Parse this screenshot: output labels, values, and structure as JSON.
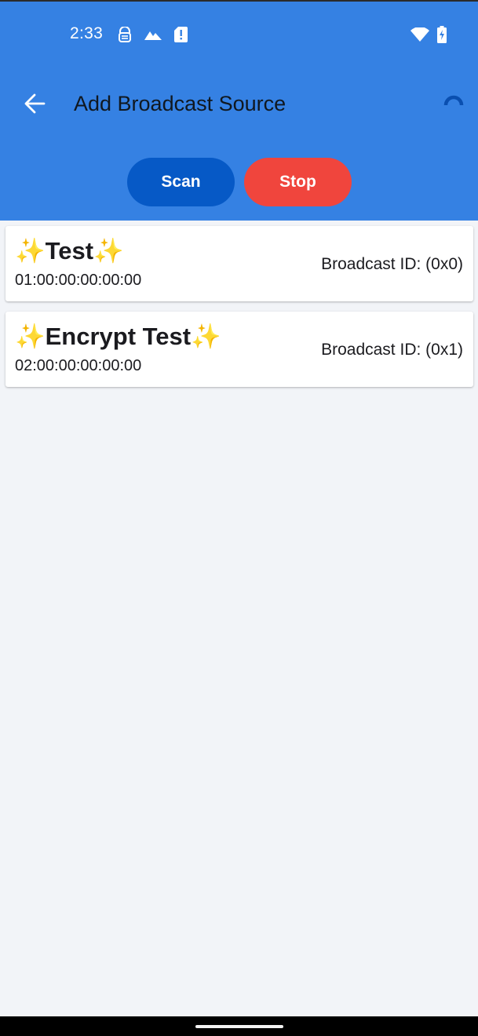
{
  "status_bar": {
    "time": "2:33",
    "left_icons": [
      "vpn-lock-icon",
      "photos-mountain-icon",
      "sim-alert-icon"
    ],
    "right_icons": [
      "wifi-icon",
      "battery-charging-icon"
    ]
  },
  "app_bar": {
    "back_icon": "arrow-back-icon",
    "title": "Add Broadcast Source",
    "progress_icon": "circular-progress-icon"
  },
  "actions": {
    "scan_label": "Scan",
    "stop_label": "Stop"
  },
  "sources": [
    {
      "sparkle": "✨",
      "name": "Test",
      "address": "01:00:00:00:00:00",
      "broadcast_id": "Broadcast ID: (0x0)"
    },
    {
      "sparkle": "✨",
      "name": "Encrypt Test",
      "address": "02:00:00:00:00:00",
      "broadcast_id": "Broadcast ID: (0x1)"
    }
  ],
  "colors": {
    "app_bar": "#3581e3",
    "scan_button": "#0659c6",
    "stop_button": "#f0453d",
    "background": "#f2f4f8",
    "card": "#ffffff"
  }
}
